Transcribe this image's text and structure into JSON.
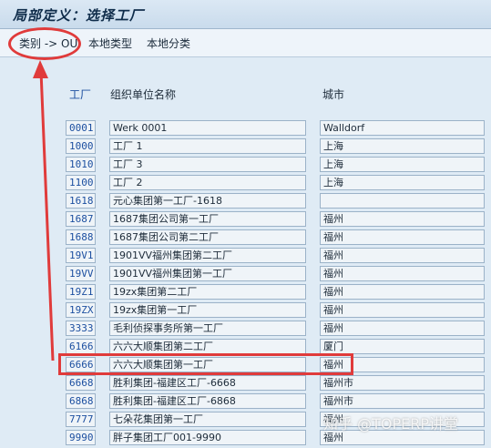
{
  "window": {
    "title": "局部定义：选择工厂"
  },
  "toolbar": {
    "buttons": [
      {
        "label": "类别  -> OU"
      },
      {
        "label": "本地类型"
      },
      {
        "label": "本地分类"
      }
    ]
  },
  "table": {
    "headers": {
      "plant": "工厂",
      "org_name": "组织单位名称",
      "city": "城市"
    },
    "rows": [
      {
        "plant": "0001",
        "name": "Werk 0001",
        "city": "Walldorf"
      },
      {
        "plant": "1000",
        "name": "工厂 1",
        "city": "上海"
      },
      {
        "plant": "1010",
        "name": "工厂 3",
        "city": "上海"
      },
      {
        "plant": "1100",
        "name": "工厂 2",
        "city": "上海"
      },
      {
        "plant": "1618",
        "name": "元心集团第一工厂-1618",
        "city": ""
      },
      {
        "plant": "1687",
        "name": "1687集团公司第一工厂",
        "city": "福州"
      },
      {
        "plant": "1688",
        "name": "1687集团公司第二工厂",
        "city": "福州"
      },
      {
        "plant": "19V1",
        "name": "1901VV福州集团第二工厂",
        "city": "福州"
      },
      {
        "plant": "19VV",
        "name": "1901VV福州集团第一工厂",
        "city": "福州"
      },
      {
        "plant": "19Z1",
        "name": "19zx集团第二工厂",
        "city": "福州"
      },
      {
        "plant": "19ZX",
        "name": "19zx集团第一工厂",
        "city": "福州"
      },
      {
        "plant": "3333",
        "name": "毛利侦探事务所第一工厂",
        "city": "福州"
      },
      {
        "plant": "6166",
        "name": "六六大顺集团第二工厂",
        "city": "厦门"
      },
      {
        "plant": "6666",
        "name": "六六大顺集团第一工厂",
        "city": "福州"
      },
      {
        "plant": "6668",
        "name": "胜利集团-福建区工厂-6668",
        "city": "福州市"
      },
      {
        "plant": "6868",
        "name": "胜利集团-福建区工厂-6868",
        "city": "福州市"
      },
      {
        "plant": "7777",
        "name": "七朵花集团第一工厂",
        "city": "福州"
      },
      {
        "plant": "9990",
        "name": "胖子集团工厂001-9990",
        "city": "福州"
      }
    ]
  },
  "watermark": "知乎 @TOPERP讲堂",
  "colors": {
    "highlight": "#e03b3b",
    "plant_code": "#1c4fa0",
    "background": "#dfebf5"
  }
}
